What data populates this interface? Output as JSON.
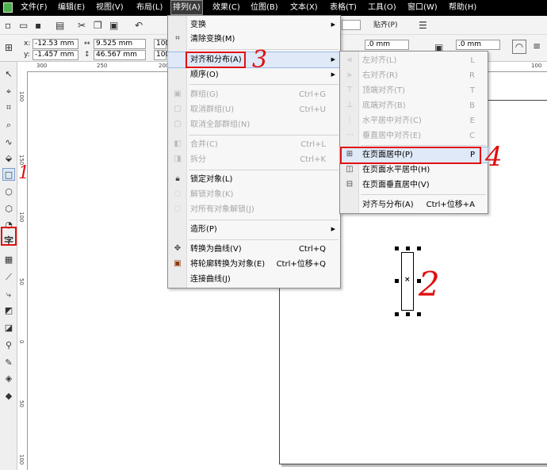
{
  "menubar": {
    "items": [
      "文件(F)",
      "编辑(E)",
      "视图(V)",
      "布局(L)",
      "排列(A)",
      "效果(C)",
      "位图(B)",
      "文本(X)",
      "表格(T)",
      "工具(O)",
      "窗口(W)",
      "帮助(H)"
    ]
  },
  "toolbar": {
    "x_value": "-12.53 mm",
    "y_value": "-1.457 mm",
    "width_value": "9.525 mm",
    "height_value": "46.567 mm",
    "scale_w": "100",
    "scale_h": "100",
    "snap_label": "贴齐(P)",
    "outline1": ".0 mm",
    "outline2": ".0 mm",
    "x_label": "x:",
    "y_label": "y:"
  },
  "ruler": {
    "h_ticks": [
      "300",
      "250",
      "200",
      "50",
      "100"
    ],
    "v_ticks": [
      "100",
      "150",
      "100",
      "50",
      "0",
      "50",
      "100",
      "150"
    ]
  },
  "arrange_menu": {
    "items": [
      {
        "label": "变换",
        "shortcut": "",
        "submenu": true,
        "disabled": false
      },
      {
        "label": "清除变换(M)",
        "shortcut": "",
        "submenu": false,
        "disabled": false
      },
      {
        "label": "对齐和分布(A)",
        "shortcut": "",
        "submenu": true,
        "disabled": false
      },
      {
        "label": "顺序(O)",
        "shortcut": "",
        "submenu": true,
        "disabled": false
      },
      {
        "label": "群组(G)",
        "shortcut": "Ctrl+G",
        "submenu": false,
        "disabled": true
      },
      {
        "label": "取消群组(U)",
        "shortcut": "Ctrl+U",
        "submenu": false,
        "disabled": true
      },
      {
        "label": "取消全部群组(N)",
        "shortcut": "",
        "submenu": false,
        "disabled": true
      },
      {
        "label": "合并(C)",
        "shortcut": "Ctrl+L",
        "submenu": false,
        "disabled": true
      },
      {
        "label": "拆分",
        "shortcut": "Ctrl+K",
        "submenu": false,
        "disabled": true
      },
      {
        "label": "锁定对象(L)",
        "shortcut": "",
        "submenu": false,
        "disabled": false
      },
      {
        "label": "解锁对象(K)",
        "shortcut": "",
        "submenu": false,
        "disabled": true
      },
      {
        "label": "对所有对象解锁(J)",
        "shortcut": "",
        "submenu": false,
        "disabled": true
      },
      {
        "label": "造形(P)",
        "shortcut": "",
        "submenu": true,
        "disabled": false
      },
      {
        "label": "转换为曲线(V)",
        "shortcut": "Ctrl+Q",
        "submenu": false,
        "disabled": false
      },
      {
        "label": "将轮廓转换为对象(E)",
        "shortcut": "Ctrl+位移+Q",
        "submenu": false,
        "disabled": false
      },
      {
        "label": "连接曲线(J)",
        "shortcut": "",
        "submenu": false,
        "disabled": false
      }
    ]
  },
  "align_submenu": {
    "items": [
      {
        "label": "左对齐(L)",
        "shortcut": "L",
        "disabled": true
      },
      {
        "label": "右对齐(R)",
        "shortcut": "R",
        "disabled": true
      },
      {
        "label": "顶端对齐(T)",
        "shortcut": "T",
        "disabled": true
      },
      {
        "label": "底端对齐(B)",
        "shortcut": "B",
        "disabled": true
      },
      {
        "label": "水平居中对齐(C)",
        "shortcut": "E",
        "disabled": true
      },
      {
        "label": "垂直居中对齐(E)",
        "shortcut": "C",
        "disabled": true
      },
      {
        "label": "在页面居中(P)",
        "shortcut": "P",
        "disabled": false
      },
      {
        "label": "在页面水平居中(H)",
        "shortcut": "",
        "disabled": false
      },
      {
        "label": "在页面垂直居中(V)",
        "shortcut": "",
        "disabled": false
      },
      {
        "label": "对齐与分布(A)",
        "shortcut": "Ctrl+位移+A",
        "disabled": false
      }
    ]
  },
  "annotations": {
    "step1": "1",
    "step2": "2",
    "step3": "3",
    "step4": "4"
  },
  "colors": {
    "highlight_red": "#e01010",
    "menubar_bg": "#000000",
    "hover_blue": "#dfe9f7"
  },
  "icons": [
    "app-logo-icon",
    "new-icon",
    "open-icon",
    "save-icon",
    "print-icon",
    "cut-icon",
    "copy-icon",
    "paste-icon",
    "undo-icon",
    "pick-tool-icon",
    "shape-tool-icon",
    "crop-tool-icon",
    "zoom-tool-icon",
    "freehand-tool-icon",
    "smart-fill-icon",
    "rectangle-tool-icon",
    "ellipse-tool-icon",
    "polygon-tool-icon",
    "basic-shapes-icon",
    "text-tool-icon",
    "table-tool-icon",
    "dimension-tool-icon",
    "connector-tool-icon",
    "blend-tool-icon",
    "transparency-tool-icon",
    "eyedropper-icon",
    "outline-pen-icon",
    "fill-bucket-icon",
    "interactive-fill-icon"
  ]
}
